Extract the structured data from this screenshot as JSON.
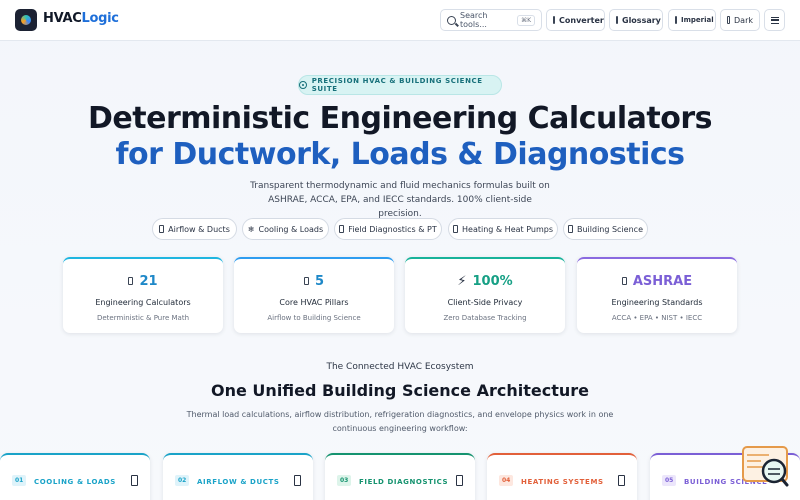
{
  "header": {
    "brand_part1": "HVAC",
    "brand_part2": "Logic",
    "search_label": "Search tools...",
    "search_shortcut": "⌘K",
    "converter_label": "Converter",
    "glossary_label": "Glossary",
    "units_label": "Imperial",
    "theme_label": "Dark"
  },
  "hero": {
    "pill_label": "PRECISION HVAC & BUILDING SCIENCE SUITE",
    "title_line1": "Deterministic Engineering Calculators",
    "title_line2": "for Ductwork, Loads & Diagnostics",
    "subtitle": "Transparent thermodynamic and fluid mechanics formulas built on ASHRAE, ACCA, EPA, and IECC standards. 100% client-side precision."
  },
  "chips": [
    {
      "label": "Airflow & Ducts"
    },
    {
      "label": "Cooling & Loads",
      "icon": "❄"
    },
    {
      "label": "Field Diagnostics & PT"
    },
    {
      "label": "Heating & Heat Pumps"
    },
    {
      "label": "Building Science"
    }
  ],
  "stats": [
    {
      "value": "21",
      "label": "Engineering Calculators",
      "note": "Deterministic & Pure Math",
      "color": "#1e88c8",
      "border": "#1fb6e0"
    },
    {
      "value": "5",
      "label": "Core HVAC Pillars",
      "note": "Airflow to Building Science",
      "color": "#1e88c8",
      "border": "#2e9df0"
    },
    {
      "value": "100%",
      "icon": "⚡",
      "label": "Client-Side Privacy",
      "note": "Zero Database Tracking",
      "color": "#16a085",
      "border": "#18b39a"
    },
    {
      "value": "ASHRAE",
      "label": "Engineering Standards",
      "note": "ACCA • EPA • NIST • IECC",
      "color": "#7b5fd6",
      "border": "#8a6ae0"
    }
  ],
  "ecosystem": {
    "kicker": "The Connected HVAC Ecosystem",
    "title": "One Unified Building Science Architecture",
    "description": "Thermal load calculations, airflow distribution, refrigeration diagnostics, and envelope physics work in one continuous engineering workflow:"
  },
  "pillars": [
    {
      "index": "01",
      "name": "COOLING & LOADS",
      "color": "#1aa3c8",
      "bg": "#dff3fa"
    },
    {
      "index": "02",
      "name": "AIRFLOW & DUCTS",
      "color": "#1aa3c8",
      "bg": "#dff3fa"
    },
    {
      "index": "03",
      "name": "FIELD DIAGNOSTICS",
      "color": "#15936f",
      "bg": "#ddf4ea"
    },
    {
      "index": "04",
      "name": "HEATING SYSTEMS",
      "color": "#e2603a",
      "bg": "#fde7df"
    },
    {
      "index": "05",
      "name": "BUILDING SCIENCE",
      "color": "#7b5fd6",
      "bg": "#ece6fb"
    }
  ]
}
